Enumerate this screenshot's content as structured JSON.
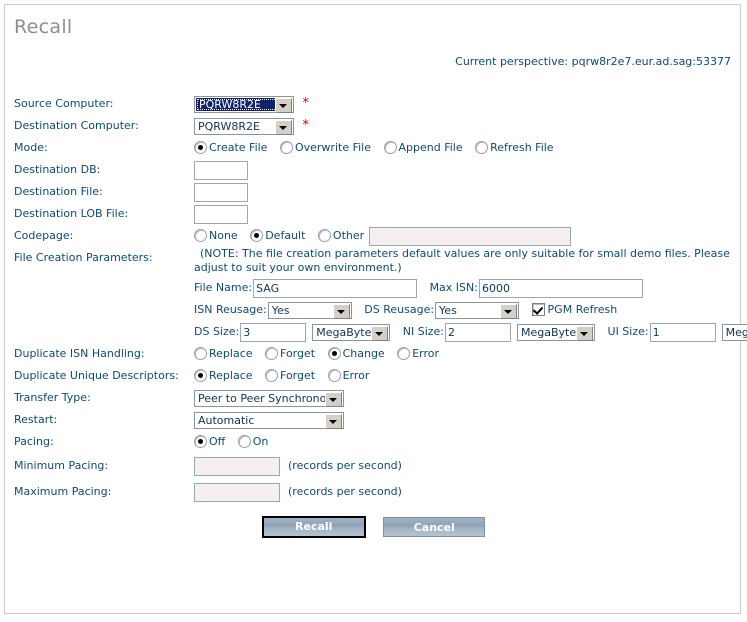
{
  "page": {
    "title": "Recall",
    "perspective": "Current perspective: pqrw8r2e7.eur.ad.sag:53377",
    "required_marker": "*"
  },
  "labels": {
    "source_computer": "Source Computer:",
    "destination_computer": "Destination Computer:",
    "mode": "Mode:",
    "destination_db": "Destination DB:",
    "destination_file": "Destination File:",
    "destination_lob_file": "Destination LOB File:",
    "codepage": "Codepage:",
    "file_creation_parameters": "File Creation Parameters:",
    "duplicate_isn_handling": "Duplicate ISN Handling:",
    "duplicate_unique_descriptors": "Duplicate Unique Descriptors:",
    "transfer_type": "Transfer Type:",
    "restart": "Restart:",
    "pacing": "Pacing:",
    "minimum_pacing": "Minimum Pacing:",
    "maximum_pacing": "Maximum Pacing:"
  },
  "source_computer": {
    "value": "PQRW8R2E",
    "focused": true
  },
  "destination_computer": {
    "value": "PQRW8R2E",
    "focused": false
  },
  "mode": {
    "options": [
      "Create File",
      "Overwrite File",
      "Append File",
      "Refresh File"
    ],
    "selected": "Create File"
  },
  "destination_db": {
    "value": "",
    "placeholder": ""
  },
  "destination_file": {
    "value": "",
    "placeholder": ""
  },
  "destination_lob_file": {
    "value": "",
    "placeholder": ""
  },
  "codepage": {
    "options": [
      "None",
      "Default",
      "Other"
    ],
    "selected": "Default",
    "other_value": "",
    "other_disabled": true
  },
  "file_creation": {
    "note": "(NOTE: The file creation parameters default values are only suitable for small demo files. Please adjust to suit your own environment.)",
    "file_name_label": "File Name:",
    "file_name_value": "SAG",
    "max_isn_label": "Max ISN:",
    "max_isn_value": "6000",
    "isn_reusage_label": "ISN Reusage:",
    "isn_reusage_value": "Yes",
    "ds_reusage_label": "DS Reusage:",
    "ds_reusage_value": "Yes",
    "pgm_refresh_label": "PGM Refresh",
    "pgm_refresh_checked": true,
    "ds_size_label": "DS Size:",
    "ds_size_value": "3",
    "ds_size_unit": "MegaBytes",
    "ni_size_label": "NI Size:",
    "ni_size_value": "2",
    "ni_size_unit": "MegaBytes",
    "ui_size_label": "UI Size:",
    "ui_size_value": "1",
    "ui_size_unit": "MegaBytes"
  },
  "duplicate_isn_handling": {
    "options": [
      "Replace",
      "Forget",
      "Change",
      "Error"
    ],
    "selected": "Change"
  },
  "duplicate_unique_descriptors": {
    "options": [
      "Replace",
      "Forget",
      "Error"
    ],
    "selected": "Replace"
  },
  "transfer_type": {
    "value": "Peer to Peer Synchronous"
  },
  "restart": {
    "value": "Automatic"
  },
  "pacing": {
    "options": [
      "Off",
      "On"
    ],
    "selected": "Off"
  },
  "minimum_pacing": {
    "value": "",
    "units": "(records per second)",
    "disabled": true
  },
  "maximum_pacing": {
    "value": "",
    "units": "(records per second)",
    "disabled": true
  },
  "buttons": {
    "submit": "Recall",
    "cancel": "Cancel"
  }
}
